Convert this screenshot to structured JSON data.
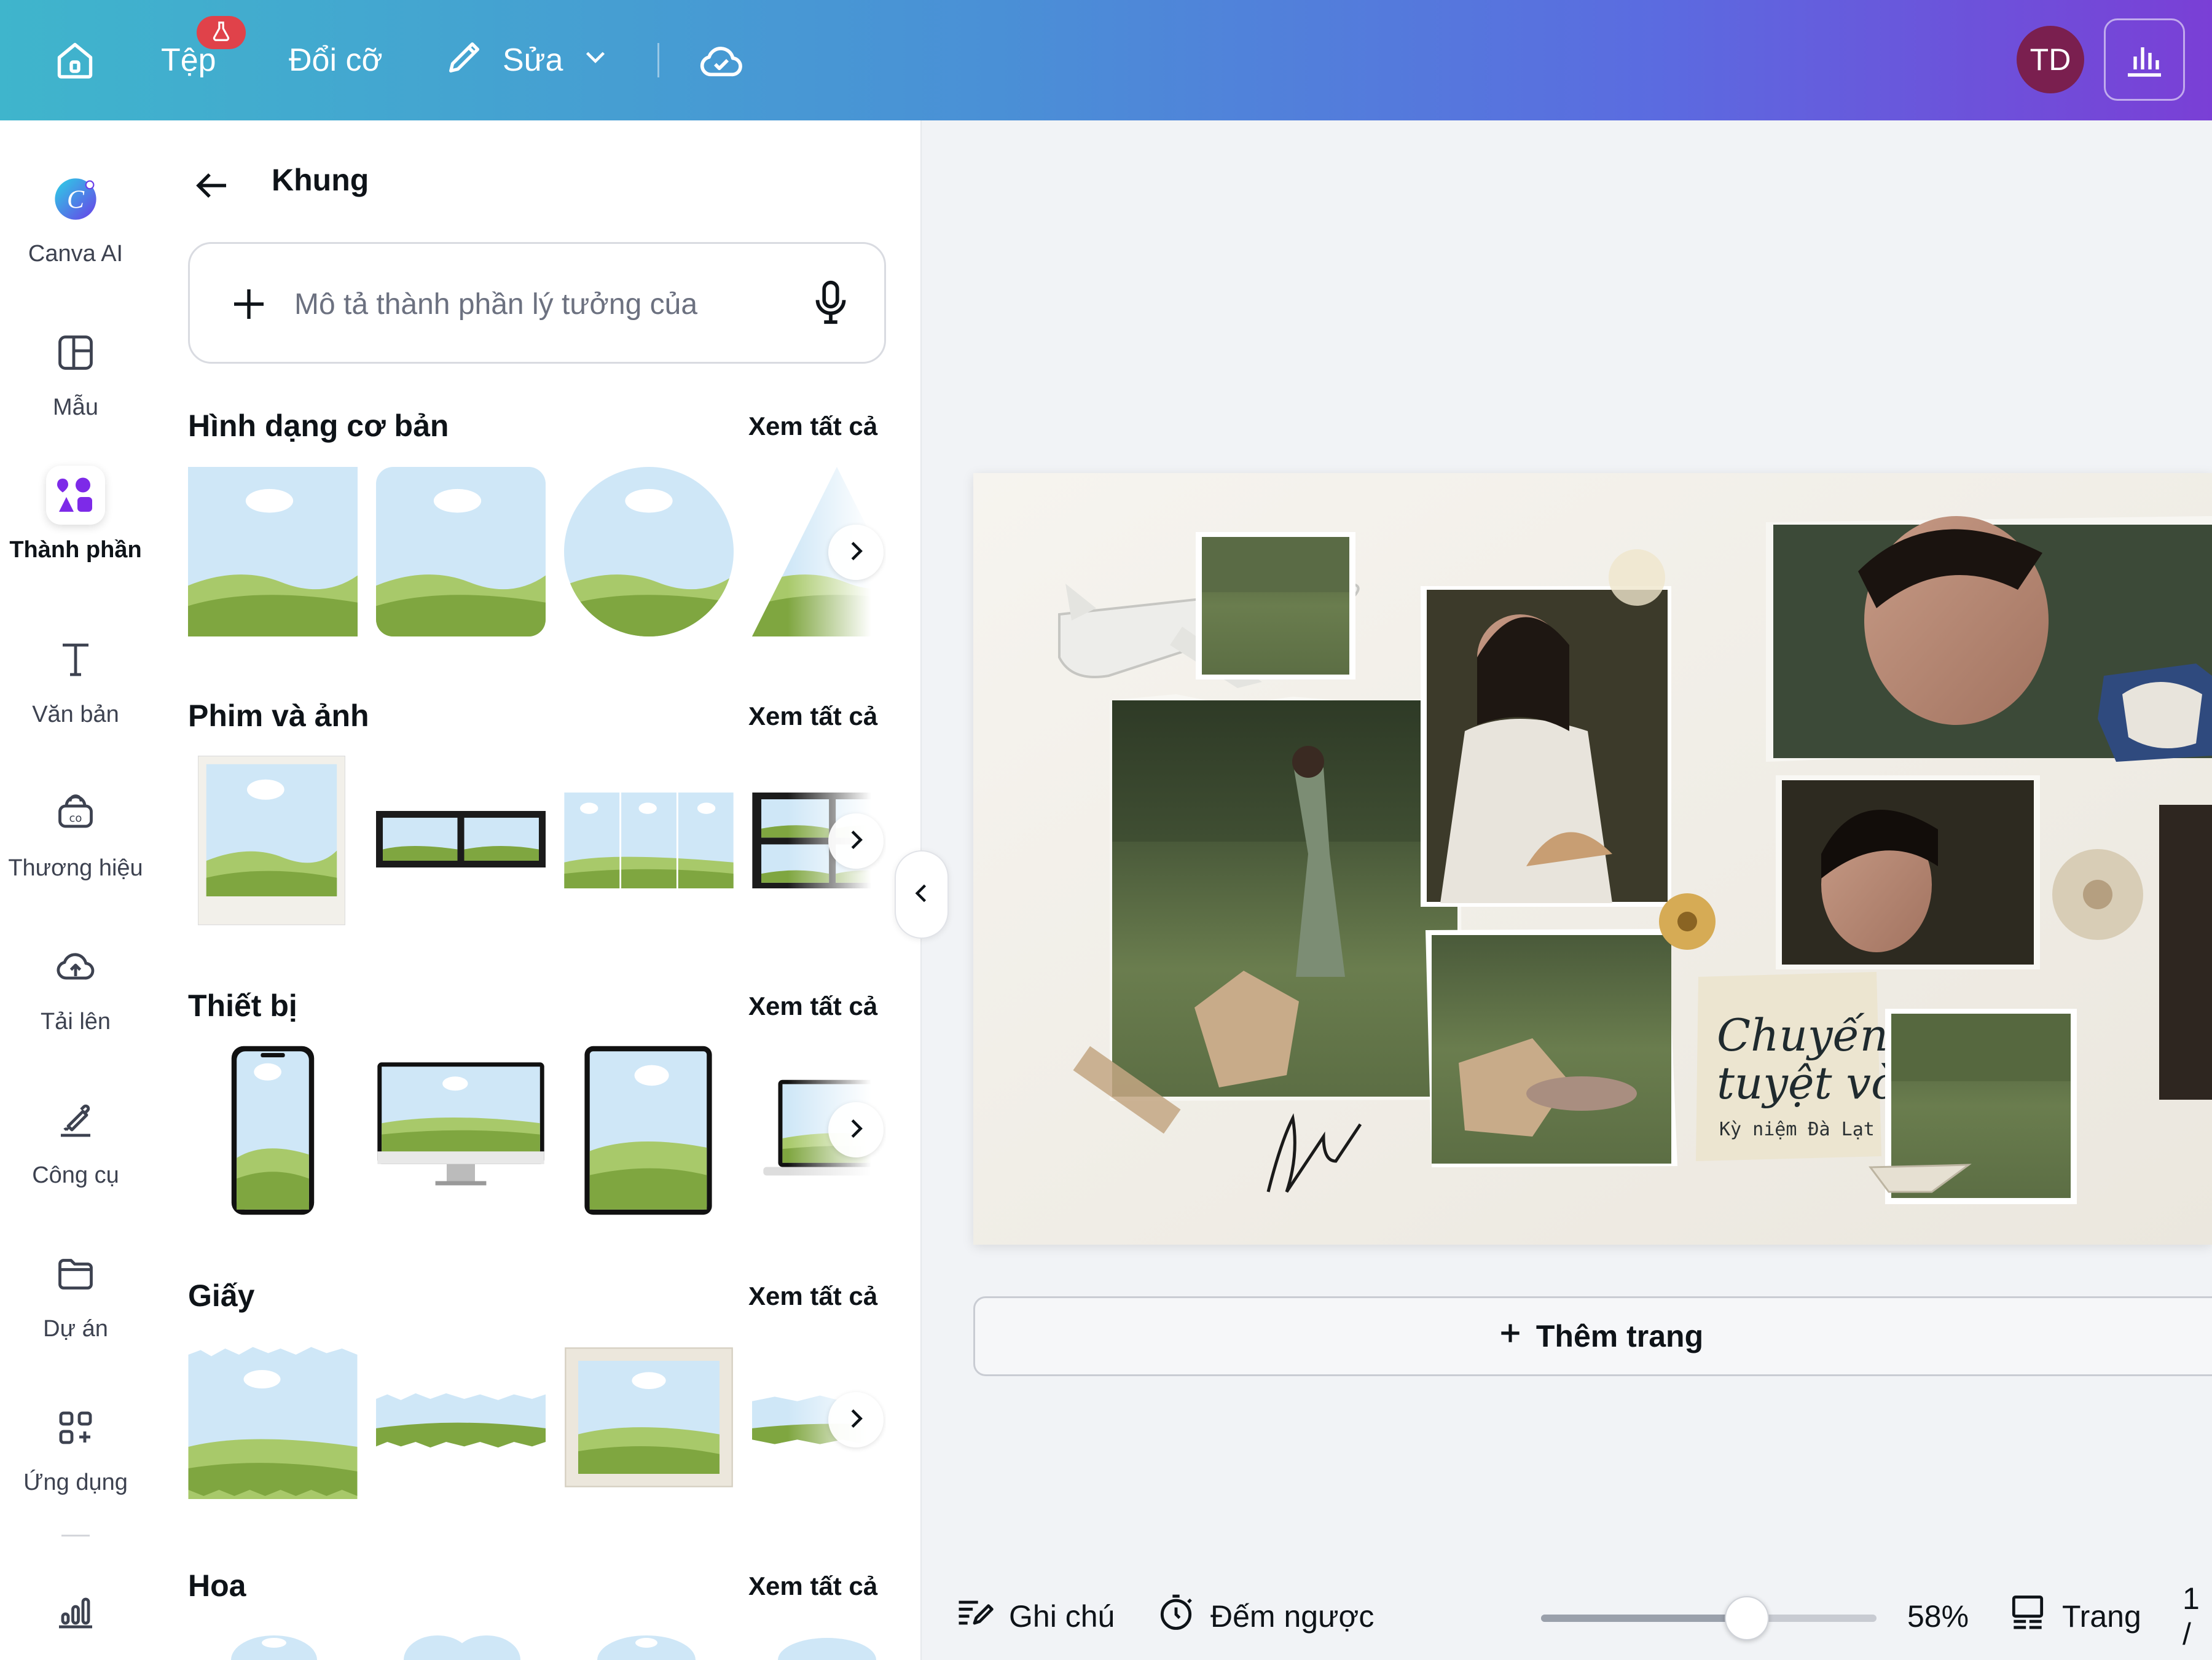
{
  "topbar": {
    "file_label": "Tệp",
    "resize_label": "Đổi cỡ",
    "edit_label": "Sửa",
    "avatar_initials": "TD"
  },
  "rail": {
    "items": [
      {
        "label": "Canva AI",
        "icon": "canva-ai-icon"
      },
      {
        "label": "Mẫu",
        "icon": "template-icon"
      },
      {
        "label": "Thành phần",
        "icon": "elements-icon",
        "active": true
      },
      {
        "label": "Văn bản",
        "icon": "text-icon"
      },
      {
        "label": "Thương hiệu",
        "icon": "brand-icon"
      },
      {
        "label": "Tải lên",
        "icon": "upload-icon"
      },
      {
        "label": "Công cụ",
        "icon": "tools-icon"
      },
      {
        "label": "Dự án",
        "icon": "folder-icon"
      },
      {
        "label": "Ứng dụng",
        "icon": "apps-icon"
      }
    ]
  },
  "panel": {
    "title": "Khung",
    "search_placeholder": "Mô tả thành phần lý tưởng của",
    "sections": [
      {
        "title": "Hình dạng cơ bản",
        "link": "Xem tất cả"
      },
      {
        "title": "Phim và ảnh",
        "link": "Xem tất cả"
      },
      {
        "title": "Thiết bị",
        "link": "Xem tất cả"
      },
      {
        "title": "Giấy",
        "link": "Xem tất cả"
      },
      {
        "title": "Hoa",
        "link": "Xem tất cả"
      }
    ]
  },
  "canvas": {
    "card_line1": "Chuyến đi",
    "card_line2": "tuyệt vời!",
    "card_caption": "Kỳ niệm Đà Lạt",
    "add_page_label": "Thêm trang"
  },
  "bottombar": {
    "notes_label": "Ghi chú",
    "timer_label": "Đếm ngược",
    "zoom_value": "58%",
    "zoom_fraction": 0.58,
    "pages_label": "Trang",
    "page_number": "1 /"
  },
  "colors": {
    "gradient_start": "#3fb5cc",
    "gradient_end": "#7a3fd6",
    "active_icon": "#7d2ae8",
    "frame_sky": "#cfe7f7",
    "frame_grass": "#7fa640"
  }
}
